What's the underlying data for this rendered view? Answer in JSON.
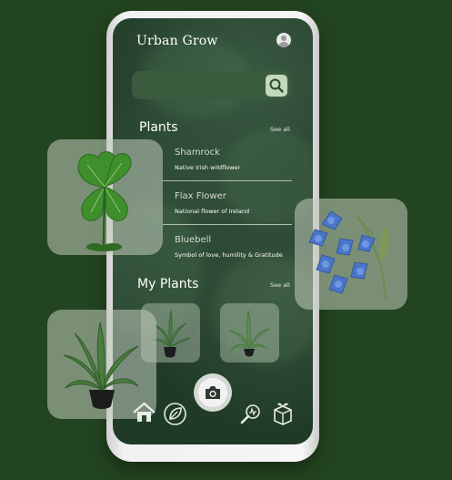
{
  "app": {
    "title": "Urban Grow"
  },
  "header": {
    "avatar_icon": "user-avatar-icon"
  },
  "search": {
    "placeholder": "",
    "icon": "search-icon"
  },
  "plants_section": {
    "title": "Plants",
    "see_all": "See all",
    "items": [
      {
        "name": "Shamrock",
        "description": "Native Irish wildflower"
      },
      {
        "name": "Flax Flower",
        "description": "National flower of Ireland"
      },
      {
        "name": "Bluebell",
        "description": "Symbol of love, humility & Gratitude"
      }
    ]
  },
  "my_plants_section": {
    "title": "My Plants",
    "see_all": "See all"
  },
  "bottom_nav": {
    "items": [
      "home-icon",
      "leaf-icon",
      "camera-icon",
      "plant-search-icon",
      "plant-box-icon"
    ]
  },
  "colors": {
    "background": "#234420",
    "screen": "#203a28",
    "search_bar": "#3a5b3e",
    "search_button": "#c4d8bf",
    "glass_card": "#c3cdbe"
  }
}
